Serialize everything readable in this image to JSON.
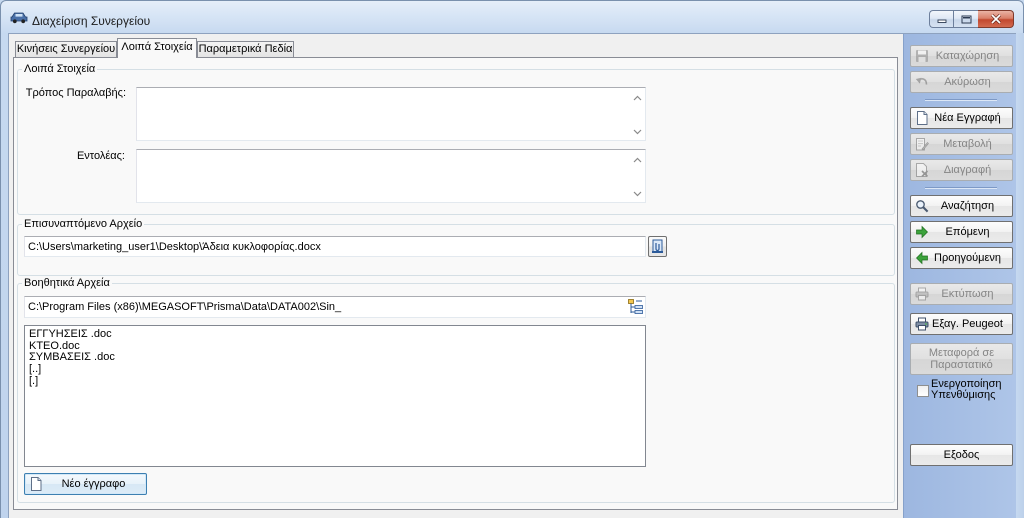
{
  "window": {
    "title": "Διαχείριση Συνεργείου",
    "icon": "car-icon",
    "controls": {
      "minimize": "minimize-icon",
      "maximize": "maximize-icon",
      "close": "close-icon"
    }
  },
  "tabs": [
    {
      "label": "Κινήσεις Συνεργείου",
      "selected": false
    },
    {
      "label": "Λοιπά Στοιχεία",
      "selected": true
    },
    {
      "label": "Παραμετρικά Πεδία",
      "selected": false
    }
  ],
  "other_details": {
    "title": "Λοιπά Στοιχεία",
    "pickup_method": {
      "label": "Τρόπος Παραλαβής:",
      "value": ""
    },
    "ordering_party": {
      "label": "Εντολέας:",
      "value": ""
    }
  },
  "attachment": {
    "title": "Επισυναπτόμενο Αρχείο",
    "path": "C:\\Users\\marketing_user1\\Desktop\\Άδεια κυκλοφορίας.docx",
    "browse_icon": "attach-file-icon"
  },
  "aux_files": {
    "title": "Βοηθητικά Αρχεία",
    "folder": "C:\\Program Files (x86)\\MEGASOFT\\Prisma\\Data\\DATA002\\Sin_",
    "folder_icon": "folder-tree-icon",
    "files": [
      "ΕΓΓΥΗΣΕΙΣ .doc",
      "ΚΤΕΟ.doc",
      "ΣΥΜΒΑΣΕΙΣ .doc",
      "[..]",
      "[.]"
    ],
    "new_document": {
      "label": "Νέο έγγραφο",
      "icon": "new-document-icon"
    }
  },
  "actions": {
    "save": {
      "label": "Καταχώρηση",
      "icon": "save-icon",
      "enabled": false
    },
    "cancel": {
      "label": "Ακύρωση",
      "icon": "undo-icon",
      "enabled": false
    },
    "new_record": {
      "label": "Νέα Εγγραφή",
      "icon": "new-record-icon",
      "enabled": true
    },
    "edit": {
      "label": "Μεταβολή",
      "icon": "edit-icon",
      "enabled": false
    },
    "delete": {
      "label": "Διαγραφή",
      "icon": "delete-icon",
      "enabled": false
    },
    "search": {
      "label": "Αναζήτηση",
      "icon": "search-icon",
      "enabled": true
    },
    "next": {
      "label": "Επόμενη",
      "icon": "next-arrow-icon",
      "enabled": true
    },
    "previous": {
      "label": "Προηγούμενη",
      "icon": "previous-arrow-icon",
      "enabled": true
    },
    "print": {
      "label": "Εκτύπωση",
      "icon": "print-icon",
      "enabled": false
    },
    "export_peugeot": {
      "label": "Εξαγ. Peugeot",
      "icon": "export-printer-icon",
      "enabled": true
    },
    "transfer": {
      "label": "Μεταφορά σε Παραστατικό",
      "enabled": false
    },
    "exit": {
      "label": "Εξοδος",
      "enabled": true
    }
  },
  "reminder": {
    "label": "Ενεργοποίηση Υπενθύμισης",
    "checked": false
  },
  "colors": {
    "panel": "#a8c0e4",
    "focus_border": "#3c7fb1",
    "close_button": "#c2482f",
    "next_arrow": "#3ca33c"
  }
}
